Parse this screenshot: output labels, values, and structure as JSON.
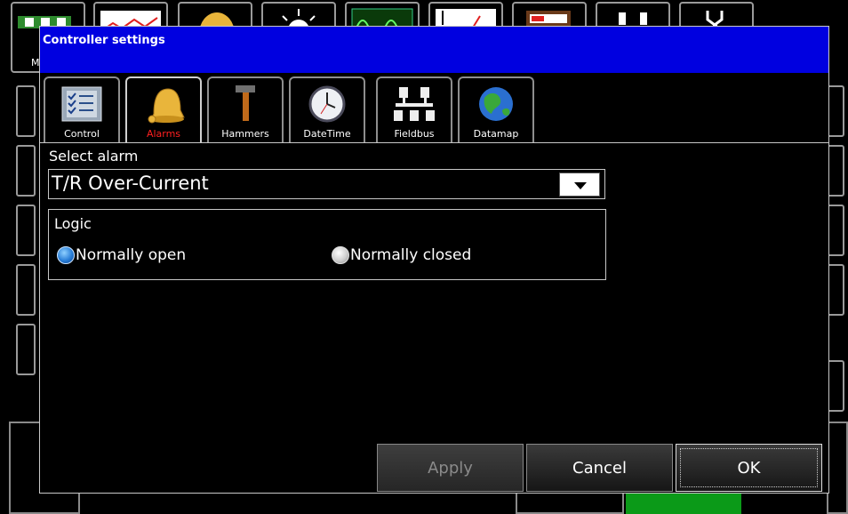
{
  "background": {
    "toolbar_tiles": [
      "main-tile",
      "trend-tile",
      "alarm-tile",
      "light-tile",
      "waveform-tile",
      "graph-tile",
      "meter-tile",
      "plug-tile",
      "tools-tile"
    ],
    "partial_letter": "M"
  },
  "dialog": {
    "title": "Controller settings",
    "tabs": [
      {
        "label": "Control",
        "icon": "checklist-icon"
      },
      {
        "label": "Alarms",
        "icon": "bell-icon"
      },
      {
        "label": "Hammers",
        "icon": "hammer-icon"
      },
      {
        "label": "DateTime",
        "icon": "clock-icon"
      },
      {
        "label": "Fieldbus",
        "icon": "network-icon"
      },
      {
        "label": "Datamap",
        "icon": "globe-icon"
      }
    ],
    "active_tab": "Alarms",
    "select_alarm_label": "Select alarm",
    "select_alarm_value": "T/R Over-Current",
    "logic": {
      "legend": "Logic",
      "options": [
        "Normally open",
        "Normally closed"
      ],
      "selected": "Normally open"
    },
    "buttons": {
      "apply": "Apply",
      "cancel": "Cancel",
      "ok": "OK"
    }
  },
  "colors": {
    "titlebar": "#0000e0",
    "active_tab_label": "#ff2020",
    "green_indicator": "#0b9a18"
  }
}
